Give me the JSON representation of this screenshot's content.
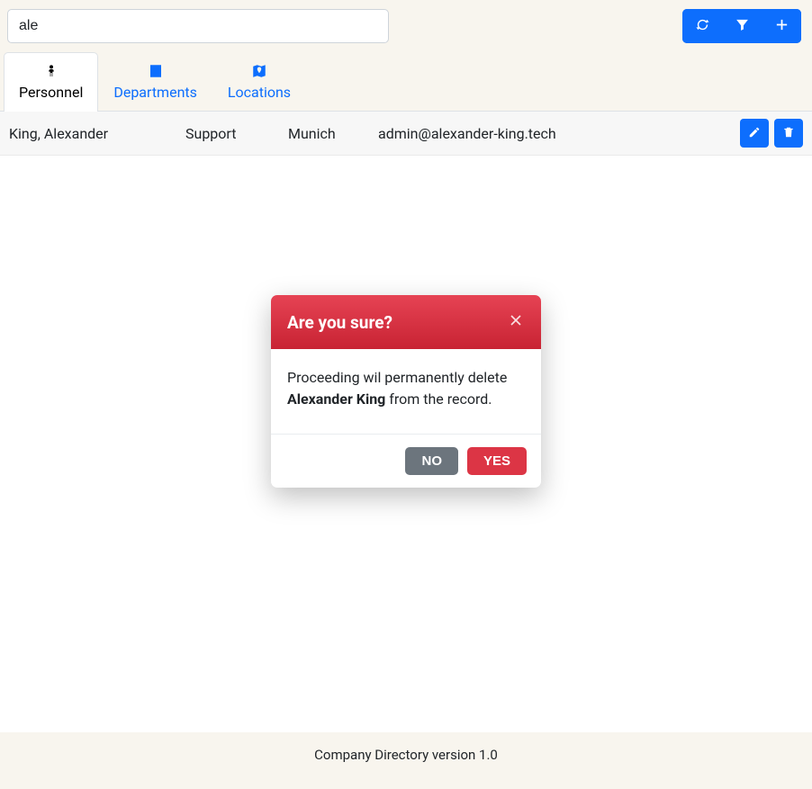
{
  "search": {
    "value": "ale"
  },
  "toolbar": {
    "refresh_icon": "refresh",
    "filter_icon": "filter",
    "add_icon": "plus"
  },
  "tabs": [
    {
      "label": "Personnel",
      "icon": "person",
      "active": true
    },
    {
      "label": "Departments",
      "icon": "building",
      "active": false
    },
    {
      "label": "Locations",
      "icon": "map-pin",
      "active": false
    }
  ],
  "rows": [
    {
      "name": "King, Alexander",
      "department": "Support",
      "location": "Munich",
      "email": "admin@alexander-king.tech"
    }
  ],
  "modal": {
    "title": "Are you sure?",
    "body_pre": "Proceeding wil permanently delete ",
    "body_name": "Alexander King",
    "body_post": " from the record.",
    "no": "NO",
    "yes": "YES"
  },
  "footer": "Company Directory version 1.0",
  "colors": {
    "primary": "#0d6efd",
    "danger": "#dc3545",
    "secondary": "#6c757d"
  }
}
